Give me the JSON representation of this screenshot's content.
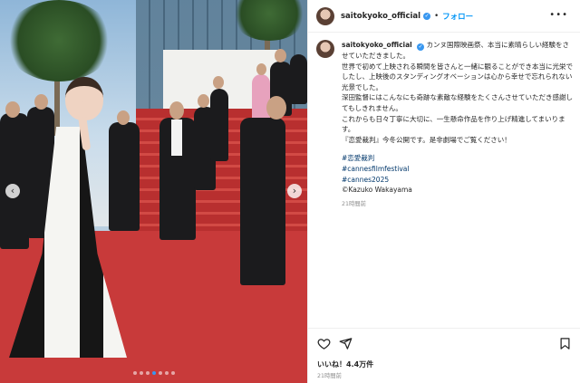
{
  "post": {
    "username": "saitokyoko_official",
    "follow_label": "フォロー",
    "separator": "•",
    "more_label": "•••",
    "carousel": {
      "prev_label": "‹",
      "next_label": "›",
      "slide_count": 7,
      "active_index": 3
    }
  },
  "caption": {
    "username": "saitokyoko_official",
    "lines": [
      "カンヌ国際映画祭、本当に素晴らしい経験をさせていただきました。",
      "世界で初めて上映される瞬間を皆さんと一緒に観ることができ本当に光栄でしたし、上映後のスタンディングオベーションは心から幸せで忘れられない光景でした。",
      "深田監督にはこんなにも奇跡な素敵な経験をたくさんさせていただき感謝してもしきれません。",
      "これからも日々丁寧に大切に、一生懸命作品を作り上げ精進してまいります。",
      "『恋愛裁判』今冬公開です。是非劇場でご覧ください！"
    ],
    "hashtags": [
      "#恋愛裁判",
      "#cannesfilmfestival",
      "#cannes2025"
    ],
    "credit": "©Kazuko Wakayama",
    "time_ago": "21時間前"
  },
  "footer": {
    "likes": "いいね！4.4万件",
    "posted": "21時間前"
  },
  "icons": {
    "heart": "heart-icon",
    "share": "share-icon",
    "bookmark": "bookmark-icon",
    "verified": "verified-badge-icon"
  },
  "colors": {
    "link": "#00376b",
    "follow": "#0095f6",
    "verified": "#3897f0"
  }
}
